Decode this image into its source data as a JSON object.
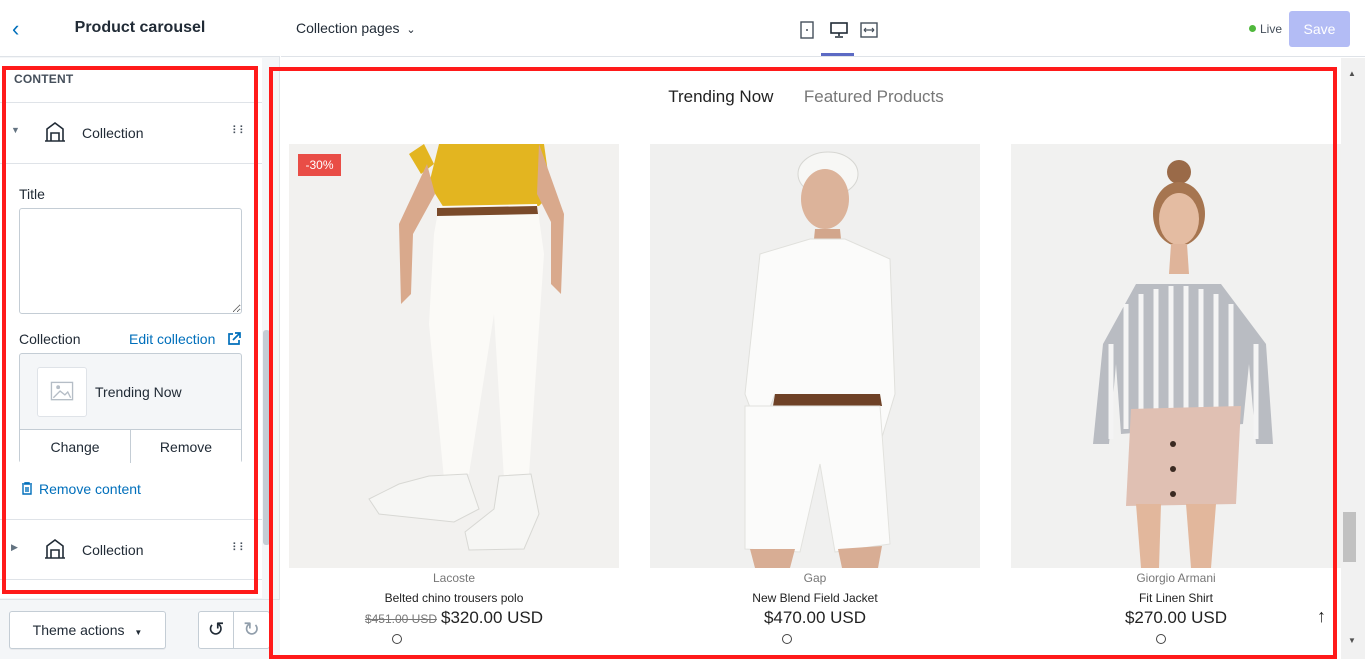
{
  "sidebar": {
    "title": "Product carousel",
    "section_label": "CONTENT",
    "blocks": [
      {
        "label": "Collection",
        "expanded": true
      },
      {
        "label": "Collection",
        "expanded": false
      }
    ],
    "title_field": {
      "label": "Title",
      "value": ""
    },
    "collection_field": {
      "label": "Collection",
      "edit_link": "Edit collection",
      "selected": "Trending Now",
      "change_label": "Change",
      "remove_label": "Remove"
    },
    "remove_content": "Remove content",
    "footer": {
      "theme_actions": "Theme actions"
    }
  },
  "topbar": {
    "page_select": "Collection pages",
    "live_label": "Live",
    "save_label": "Save",
    "colors": {
      "live": "#50b83c",
      "save_bg": "#b3bcf5",
      "accent": "#5c6ac4"
    }
  },
  "preview": {
    "tabs": [
      "Trending Now",
      "Featured Products"
    ],
    "products": [
      {
        "brand": "Lacoste",
        "name": "Belted chino trousers polo",
        "old_price": "$451.00 USD",
        "price": "$320.00 USD",
        "badge": "-30%"
      },
      {
        "brand": "Gap",
        "name": "New Blend Field Jacket",
        "old_price": "",
        "price": "$470.00 USD"
      },
      {
        "brand": "Giorgio Armani",
        "name": "Fit Linen Shirt",
        "old_price": "",
        "price": "$270.00 USD"
      }
    ],
    "scroll_top_icon": "↑"
  },
  "icons": {
    "back": "chevron-left-icon",
    "block": "building-icon",
    "drag": "drag-handle-icon",
    "external": "external-link-icon",
    "trash": "trash-icon",
    "undo": "undo-icon",
    "redo": "redo-icon"
  }
}
